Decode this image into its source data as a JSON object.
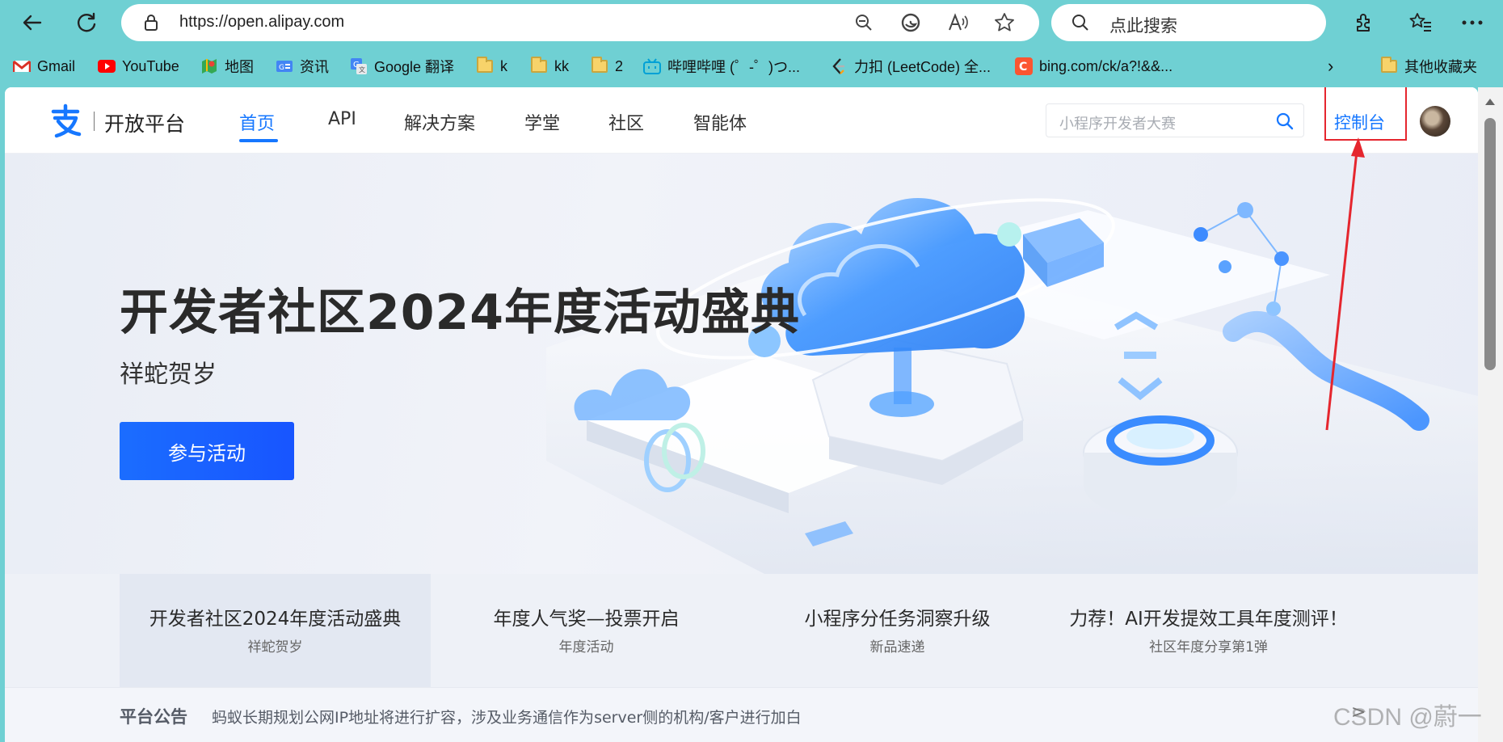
{
  "browser": {
    "url": "https://open.alipay.com",
    "search_placeholder": "点此搜索",
    "bookmarks": [
      {
        "label": "Gmail",
        "icon": "gmail-icon"
      },
      {
        "label": "YouTube",
        "icon": "youtube-icon"
      },
      {
        "label": "地图",
        "icon": "maps-icon"
      },
      {
        "label": "资讯",
        "icon": "news-icon"
      },
      {
        "label": "Google 翻译",
        "icon": "translate-icon"
      },
      {
        "label": "k",
        "icon": "folder-icon"
      },
      {
        "label": "kk",
        "icon": "folder-icon"
      },
      {
        "label": "2",
        "icon": "folder-icon"
      },
      {
        "label": "哔哩哔哩 (゜-゜)つ...",
        "icon": "bilibili-icon"
      },
      {
        "label": "力扣 (LeetCode) 全...",
        "icon": "leetcode-icon"
      },
      {
        "label": "bing.com/ck/a?!&&...",
        "icon": "bing-icon"
      },
      {
        "label": "其他收藏夹",
        "icon": "folder-icon"
      }
    ]
  },
  "site": {
    "logo_text": "开放平台",
    "nav": [
      "首页",
      "API",
      "解决方案",
      "学堂",
      "社区",
      "智能体"
    ],
    "search_placeholder": "小程序开发者大赛",
    "console_label": "控制台"
  },
  "hero": {
    "title": "开发者社区2024年度活动盛典",
    "subtitle": "祥蛇贺岁",
    "button_label": "参与活动"
  },
  "cards": [
    {
      "title": "开发者社区2024年度活动盛典",
      "subtitle": "祥蛇贺岁"
    },
    {
      "title": "年度人气奖—投票开启",
      "subtitle": "年度活动"
    },
    {
      "title": "小程序分任务洞察升级",
      "subtitle": "新品速递"
    },
    {
      "title": "力荐！AI开发提效工具年度测评！",
      "subtitle": "社区年度分享第1弹"
    }
  ],
  "notice": {
    "label": "平台公告",
    "message": "蚂蚁长期规划公网IP地址将进行扩容，涉及业务通信作为server侧的机构/客户进行加白",
    "arrow": ">"
  },
  "watermark": "CSDN @蔚一",
  "colors": {
    "browser_frame": "#6fd0d3",
    "brand_blue": "#1677ff",
    "annotation_red": "#e5262e"
  }
}
